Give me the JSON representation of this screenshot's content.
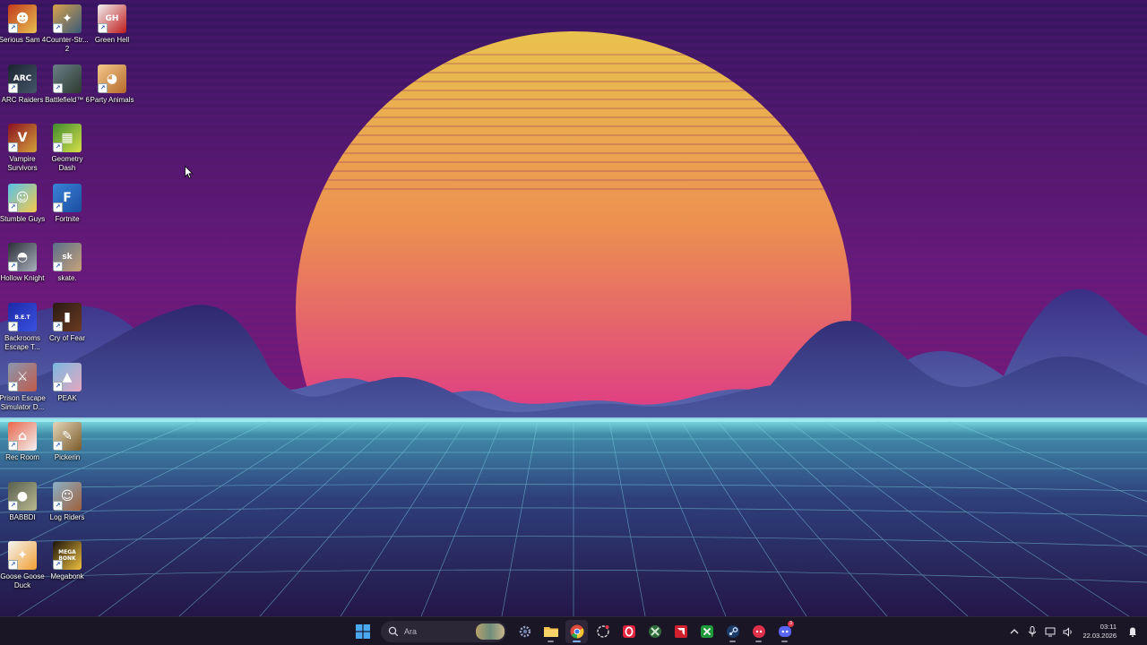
{
  "desktop": {
    "icons": [
      {
        "label": "Serious Sam 4",
        "colors": [
          "#c23a1c",
          "#e8c050"
        ],
        "glyph": "☻",
        "icon": "serious-sam-icon"
      },
      {
        "label": "Counter-Str... 2",
        "colors": [
          "#d8a24a",
          "#3a5a7a"
        ],
        "glyph": "✦",
        "icon": "counter-strike-icon"
      },
      {
        "label": "Green Hell",
        "colors": [
          "#f0f0f0",
          "#c01a1a"
        ],
        "glyph": "GH",
        "icon": "green-hell-icon"
      },
      {
        "label": "ARC Raiders",
        "colors": [
          "#1c2330",
          "#44566a"
        ],
        "glyph": "ARC",
        "icon": "arc-raiders-icon"
      },
      {
        "label": "Battlefield™ 6",
        "colors": [
          "#6a7f86",
          "#2d3a2f"
        ],
        "glyph": "",
        "icon": "battlefield-icon"
      },
      {
        "label": "Party Animals",
        "colors": [
          "#f3c98a",
          "#b56a2a"
        ],
        "glyph": "◕",
        "icon": "party-animals-icon"
      },
      {
        "label": "Vampire Survivors",
        "colors": [
          "#8a1020",
          "#d4a23a"
        ],
        "glyph": "V",
        "icon": "vampire-survivors-icon"
      },
      {
        "label": "Geometry Dash",
        "colors": [
          "#3f8a2e",
          "#d6e04a"
        ],
        "glyph": "▦",
        "icon": "geometry-dash-icon"
      },
      {
        "label": "Stumble Guys",
        "colors": [
          "#58c2e8",
          "#f5c84a"
        ],
        "glyph": "☺",
        "icon": "stumble-guys-icon"
      },
      {
        "label": "Fortnite",
        "colors": [
          "#3a82d8",
          "#1b4ea0"
        ],
        "glyph": "F",
        "icon": "fortnite-icon"
      },
      {
        "label": "Hollow Knight",
        "colors": [
          "#2a2e38",
          "#a8b0bc"
        ],
        "glyph": "◓",
        "icon": "hollow-knight-icon"
      },
      {
        "label": "skate.",
        "colors": [
          "#5a6e8a",
          "#c8a27a"
        ],
        "glyph": "sk",
        "icon": "skate-icon"
      },
      {
        "label": "Backrooms Escape T...",
        "colors": [
          "#1c2aa8",
          "#3a52e0"
        ],
        "glyph": "B.E.T",
        "icon": "backrooms-icon"
      },
      {
        "label": "Cry of Fear",
        "colors": [
          "#2b1a14",
          "#6a3a22"
        ],
        "glyph": "▮",
        "icon": "cry-of-fear-icon"
      },
      {
        "label": "Prison Escape Simulator D...",
        "colors": [
          "#8a98b0",
          "#c05a4a"
        ],
        "glyph": "⚔",
        "icon": "prison-escape-icon"
      },
      {
        "label": "PEAK",
        "colors": [
          "#7ab8e0",
          "#e6a8c0"
        ],
        "glyph": "▲",
        "icon": "peak-icon"
      },
      {
        "label": "Rec Room",
        "colors": [
          "#e8664a",
          "#f2f2f2"
        ],
        "glyph": "⌂",
        "icon": "rec-room-icon"
      },
      {
        "label": "Pickerin",
        "colors": [
          "#e4d6b8",
          "#7a5a2a"
        ],
        "glyph": "✎",
        "icon": "pickerin-icon"
      },
      {
        "label": "BABBDI",
        "colors": [
          "#5a6050",
          "#b8b890"
        ],
        "glyph": "●",
        "icon": "babbdi-icon"
      },
      {
        "label": "Log Riders",
        "colors": [
          "#8ab0c8",
          "#a0603a"
        ],
        "glyph": "☺",
        "icon": "log-riders-icon"
      },
      {
        "label": "Goose Goose Duck",
        "colors": [
          "#f4f4f4",
          "#f0a030"
        ],
        "glyph": "✦",
        "icon": "goose-goose-duck-icon"
      },
      {
        "label": "Megabonk",
        "colors": [
          "#1a1208",
          "#f0c040"
        ],
        "glyph": "MEGA BONK",
        "icon": "megabonk-icon"
      }
    ]
  },
  "wallpaper": {
    "sky_top": "#3a1866",
    "sky_mid": "#6e1c7e",
    "sun_top": "#e8b84a",
    "sun_bottom": "#d0248a",
    "grid": "#6fd4e0",
    "hills": "#3b2a78"
  },
  "taskbar": {
    "search_placeholder": "Ara",
    "apps": [
      {
        "name": "start-icon",
        "active": false
      },
      {
        "name": "settings-icon",
        "active": false
      },
      {
        "name": "file-explorer-icon",
        "active": false
      },
      {
        "name": "chrome-icon",
        "active": true
      },
      {
        "name": "chatgpt-icon",
        "active": false
      },
      {
        "name": "opera-gx-icon",
        "active": false
      },
      {
        "name": "xbox-overlay-icon",
        "active": false
      },
      {
        "name": "amd-software-icon",
        "active": false
      },
      {
        "name": "xbox-icon",
        "active": false
      },
      {
        "name": "steam-icon",
        "active": false
      },
      {
        "name": "discord-canary-icon",
        "active": false
      },
      {
        "name": "discord-icon",
        "active": false
      }
    ],
    "discord_badge": "3",
    "time": "03:11",
    "date": "22.03.2026"
  }
}
